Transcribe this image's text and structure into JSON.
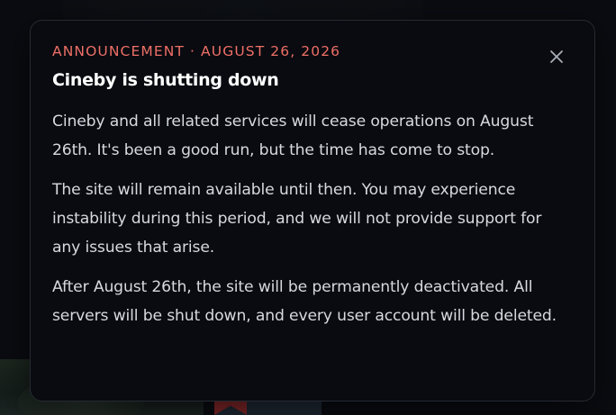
{
  "announcement": {
    "eyebrow": "ANNOUNCEMENT · AUGUST 26, 2026",
    "title": "Cineby is shutting down",
    "paragraphs": [
      "Cineby and all related services will cease operations on August 26th. It's been a good run, but the time has come to stop.",
      "The site will remain available until then. You may experience instability during this period, and we will not provide support for any issues that arise.",
      "After August 26th, the site will be permanently deactivated. All servers will be shut down, and every user account will be deleted."
    ],
    "close_icon": "close-icon",
    "accent_color": "#ee6f67"
  }
}
